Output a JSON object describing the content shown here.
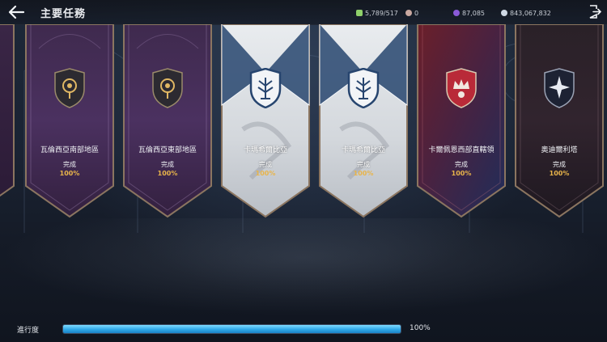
{
  "header": {
    "title": "主要任務",
    "back_icon": "arrow-left-icon",
    "exit_icon": "exit-door-icon"
  },
  "resources": [
    {
      "icon": "stamina-icon",
      "value": "5,789/517",
      "color": "#8fd06a"
    },
    {
      "icon": "gem-icon",
      "value": "0",
      "color": "#c9a8a0"
    },
    {
      "icon": "crystal-icon",
      "value": "87,085",
      "color": "#8a5ad8"
    },
    {
      "icon": "silver-coin-icon",
      "value": "843,067,832",
      "color": "#cfd8e4"
    }
  ],
  "banners": [
    {
      "name": "",
      "status": "",
      "percent": "",
      "theme": "purple",
      "emblem": "ring-emblem-icon"
    },
    {
      "name": "瓦倫西亞南部地區",
      "status": "完成",
      "percent": "100%",
      "theme": "purple",
      "emblem": "ring-emblem-icon"
    },
    {
      "name": "瓦倫西亞東部地區",
      "status": "完成",
      "percent": "100%",
      "theme": "purple",
      "emblem": "ring-emblem-icon"
    },
    {
      "name": "卡瑪希爾比亞",
      "status": "完成",
      "percent": "100%",
      "theme": "white",
      "emblem": "tree-emblem-icon"
    },
    {
      "name": "卡瑪希爾比亞",
      "status": "完成",
      "percent": "100%",
      "theme": "white",
      "emblem": "tree-emblem-icon"
    },
    {
      "name": "卡爾佩恩西部直轄領",
      "status": "完成",
      "percent": "100%",
      "theme": "red",
      "emblem": "crown-emblem-icon"
    },
    {
      "name": "奧迪爾利塔",
      "status": "完成",
      "percent": "100%",
      "theme": "dark",
      "emblem": "star-emblem-icon"
    }
  ],
  "progress": {
    "label": "進行度",
    "value": 1.0,
    "value_text": "100%"
  }
}
